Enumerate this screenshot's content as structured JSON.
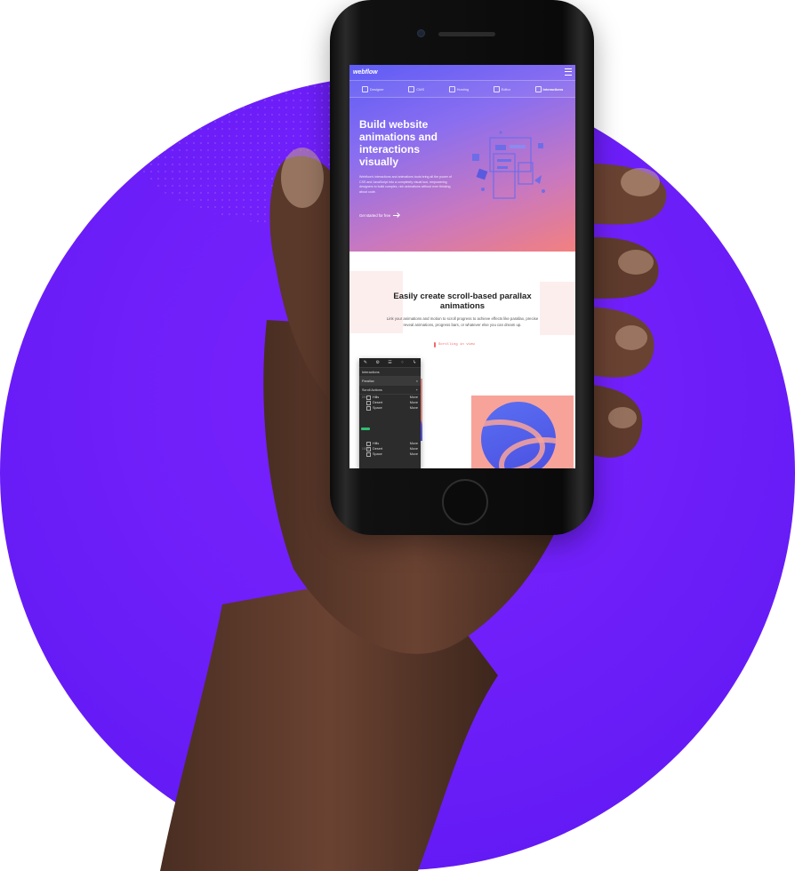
{
  "app": {
    "logo": "webflow",
    "nav": [
      {
        "label": "Designer"
      },
      {
        "label": "CMS"
      },
      {
        "label": "Hosting"
      },
      {
        "label": "Editor"
      },
      {
        "label": "Interactions"
      }
    ]
  },
  "hero": {
    "title": "Build website animations and interactions visually",
    "body": "Webflow's interactions and animations tools bring all the power of CSS and JavaScript into a completely visual tool, empowering designers to build complex, rich animations without ever thinking about code.",
    "cta": "Get started for free"
  },
  "section2": {
    "title": "Easily create scroll-based parallax animations",
    "body": "Link your animations and motion to scroll progress to achieve effects like parallax, precise reveal animations, progress bars, or whatever else you can dream up.",
    "scroll_label": "Scrolling in view"
  },
  "panel": {
    "title": "Interactions",
    "selected": "Parallax",
    "group": "Scroll Actions",
    "label_top": "0%",
    "label_bottom": "100%",
    "items_top": [
      {
        "name": "Hills",
        "action": "Move"
      },
      {
        "name": "Desert",
        "action": "Move"
      },
      {
        "name": "Space",
        "action": "Move"
      }
    ],
    "items_bottom": [
      {
        "name": "Hills",
        "action": "Move"
      },
      {
        "name": "Desert",
        "action": "Move"
      },
      {
        "name": "Space",
        "action": "Move"
      }
    ]
  },
  "colors": {
    "circle": "#6f1ff9",
    "hero_start": "#5e5cf6",
    "hero_end": "#f2807f",
    "accent": "#f06a6a"
  }
}
